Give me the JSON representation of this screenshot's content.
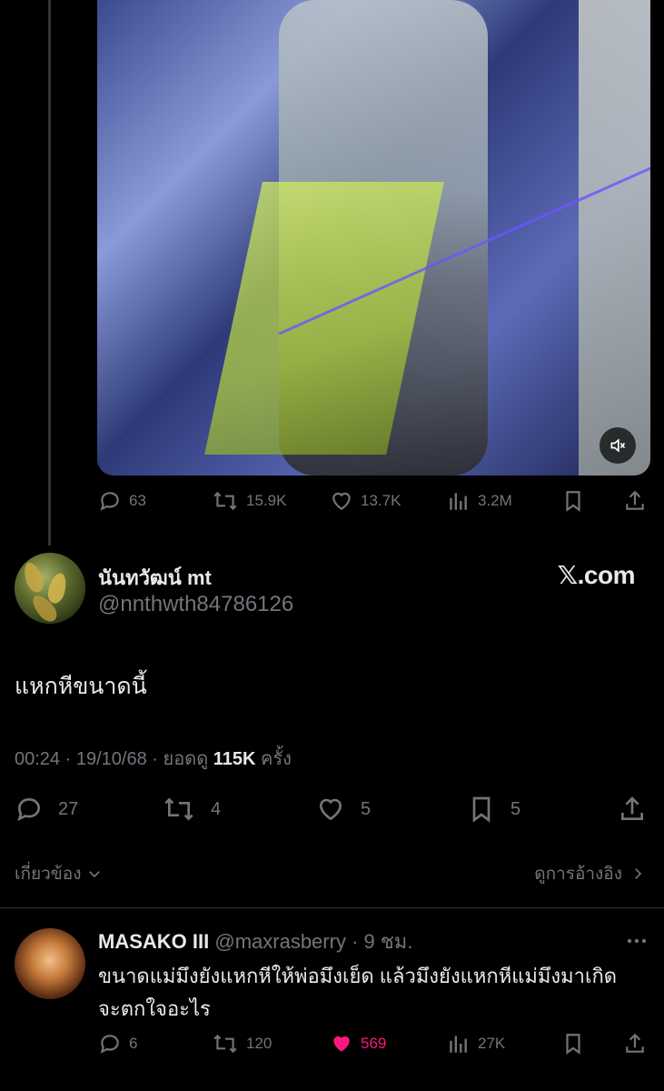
{
  "first_tweet": {
    "stats": {
      "replies": "63",
      "reposts": "15.9K",
      "likes": "13.7K",
      "views": "3.2M"
    }
  },
  "main_tweet": {
    "display_name": "นันทวัฒน์ mt",
    "handle": "@nnthwth84786126",
    "brand": "𝕏.com",
    "text": "แหกหีขนาดนี้",
    "time": "00:24",
    "date": "19/10/68",
    "views_label": "ยอดดู",
    "views_count": "115K",
    "views_suffix": "ครั้ง",
    "stats": {
      "replies": "27",
      "reposts": "4",
      "likes": "5",
      "bookmarks": "5"
    },
    "related_label": "เกี่ยวข้อง",
    "quotes_label": "ดูการอ้างอิง"
  },
  "reply": {
    "display_name": "MASAKO III",
    "handle": "@maxrasberry",
    "age": "9 ชม.",
    "text": "ขนาดแม่มึงยังแหกหีให้พ่อมึงเย็ด แล้วมึงยังแหกหีแม่มึงมาเกิด จะตกใจอะไร",
    "stats": {
      "replies": "6",
      "reposts": "120",
      "likes": "569",
      "views": "27K"
    }
  },
  "colors": {
    "background": "#000000",
    "text_primary": "#e7e9ea",
    "text_secondary": "#71767b",
    "like_active": "#f91880",
    "divider": "#2f3336"
  }
}
